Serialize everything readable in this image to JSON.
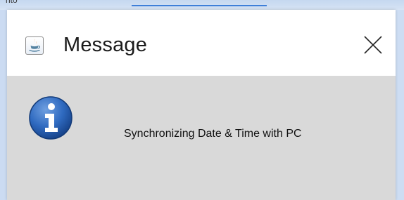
{
  "background": {
    "top_text": "nto"
  },
  "dialog": {
    "title": "Message",
    "app_icon": "java-icon",
    "close_icon": "close-icon",
    "message": "Synchronizing Date & Time with PC",
    "message_icon": "info-icon"
  },
  "colors": {
    "titlebar": "#ffffff",
    "content_bg": "#d9d9d9",
    "info_blue": "#1f5aa8",
    "java_orange": "#e76f00",
    "java_blue": "#5382a1"
  }
}
